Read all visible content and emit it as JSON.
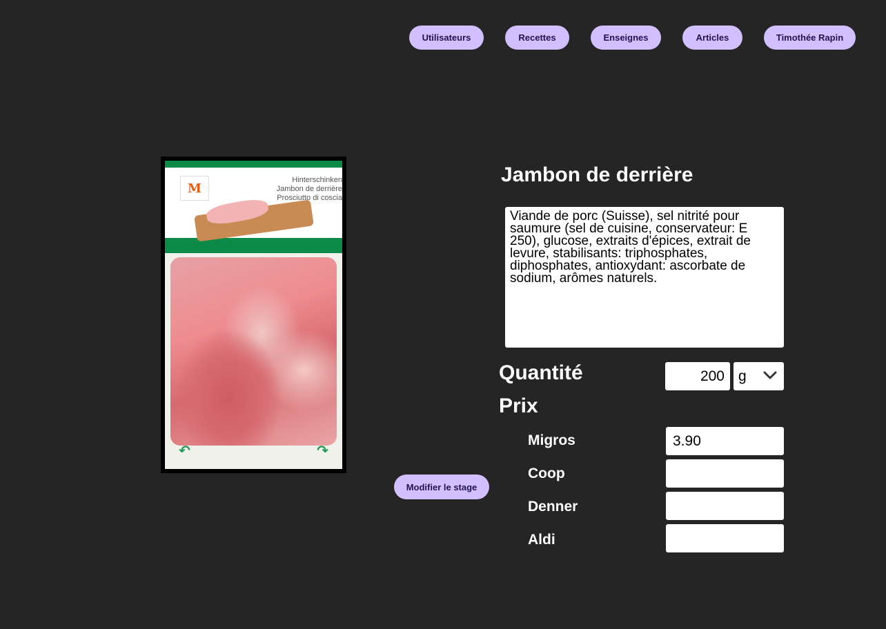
{
  "nav": {
    "items": [
      {
        "label": "Utilisateurs"
      },
      {
        "label": "Recettes"
      },
      {
        "label": "Enseignes"
      },
      {
        "label": "Articles"
      },
      {
        "label": "Timothée Rapin"
      }
    ]
  },
  "product": {
    "name": "Jambon de derrière",
    "image_alt_lines": [
      "Hinterschinken",
      "Jambon de derrière",
      "Prosciutto di coscia"
    ],
    "description": "Viande de porc (Suisse), sel nitrité pour saumure (sel de cuisine, conservateur: E 250), glucose, extraits d'épices, extrait de levure, stabilisants: triphosphates, diphosphates, antioxydant: ascorbate de sodium, arômes naturels.",
    "quantity_label": "Quantité",
    "quantity_value": "200",
    "unit_value": "g",
    "price_label": "Prix",
    "prices": [
      {
        "store": "Migros",
        "value": "3.90"
      },
      {
        "store": "Coop",
        "value": ""
      },
      {
        "store": "Denner",
        "value": ""
      },
      {
        "store": "Aldi",
        "value": ""
      }
    ]
  },
  "actions": {
    "edit_label": "Modifier le stage"
  },
  "colors": {
    "background": "#252525",
    "pill": "#d2bfff",
    "pill_text": "#1f1450"
  },
  "icons": {
    "unit_dropdown": "chevron-down-icon"
  }
}
